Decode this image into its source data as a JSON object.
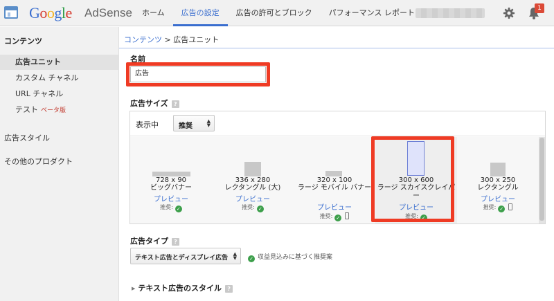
{
  "header": {
    "logo_google": "Google",
    "product": "AdSense",
    "nav": [
      {
        "label": "ホーム",
        "active": false
      },
      {
        "label": "広告の設定",
        "active": true
      },
      {
        "label": "広告の許可とブロック",
        "active": false
      },
      {
        "label": "パフォーマンス レポート",
        "active": false
      }
    ],
    "notification_count": "1"
  },
  "sidebar": {
    "section": "コンテンツ",
    "items": [
      {
        "label": "広告ユニット",
        "active": true
      },
      {
        "label": "カスタム チャネル"
      },
      {
        "label": "URL チャネル"
      },
      {
        "label": "テスト",
        "badge": "ベータ版"
      }
    ],
    "top_items": [
      "広告スタイル",
      "その他のプロダクト"
    ]
  },
  "breadcrumb": {
    "parent": "コンテンツ",
    "separator": " > ",
    "current": "広告ユニット"
  },
  "name_field": {
    "label": "名前",
    "value": "広告"
  },
  "ad_size": {
    "label": "広告サイズ",
    "filter_label": "表示中",
    "filter_value": "推奨",
    "recommended_label": "推奨:",
    "preview_label": "プレビュー",
    "cards": [
      {
        "dims": "728 x 90",
        "name": "ビッグバナー",
        "mobile": false
      },
      {
        "dims": "336 x 280",
        "name": "レクタングル (大)",
        "mobile": false
      },
      {
        "dims": "320 x 100",
        "name": "ラージ モバイル バナー",
        "mobile": true
      },
      {
        "dims": "300 x 600",
        "name": "ラージ スカイスクレイパー",
        "mobile": false,
        "selected": true
      },
      {
        "dims": "300 x 250",
        "name": "レクタングル",
        "mobile": true
      }
    ]
  },
  "ad_type": {
    "label": "広告タイプ",
    "value": "テキスト広告とディスプレイ広告",
    "note": "収益見込みに基づく推奨案"
  },
  "text_style": {
    "label": "テキスト広告のスタイル"
  },
  "colors": {
    "accent": "#3a6ecf",
    "highlight": "#ef3b24",
    "check": "#3d9f4b"
  }
}
